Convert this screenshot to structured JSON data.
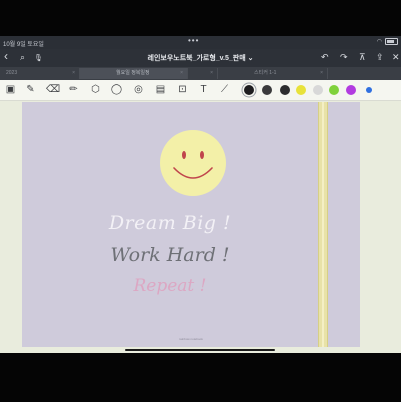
{
  "status": {
    "time": "10월 9일 토요일",
    "dots": "•••",
    "battery_label": "100%"
  },
  "nav": {
    "title": "레인보우노트북_가로형_v.5_판매",
    "title_caret": "⌄",
    "back": "‹",
    "search": "⌕",
    "mic": "🎙",
    "undo": "↶",
    "redo": "↷",
    "bookmark": "⊼",
    "share": "⇪",
    "close": "✕"
  },
  "tabs": [
    {
      "label": "2023",
      "close": "×",
      "active": false
    },
    {
      "label": "월요일 정복일정",
      "close": "×",
      "active": true
    },
    {
      "label": "",
      "close": "×",
      "active": false
    },
    {
      "label": "스티커 1-1",
      "close": "×",
      "active": false
    },
    {
      "label": "",
      "close": "",
      "active": false
    }
  ],
  "tools": [
    {
      "name": "thumbnail-icon",
      "glyph": "▣"
    },
    {
      "name": "pen-icon",
      "glyph": "✎"
    },
    {
      "name": "eraser-icon",
      "glyph": "⌫"
    },
    {
      "name": "highlighter-icon",
      "glyph": "✏"
    },
    {
      "name": "shapes-icon",
      "glyph": "⬡"
    },
    {
      "name": "lasso-icon",
      "glyph": "◯"
    },
    {
      "name": "sticker-icon",
      "glyph": "◎"
    },
    {
      "name": "image-icon",
      "glyph": "▤"
    },
    {
      "name": "camera-icon",
      "glyph": "⊡"
    },
    {
      "name": "text-icon",
      "glyph": "T"
    },
    {
      "name": "laser-icon",
      "glyph": "⟋"
    }
  ],
  "colors": {
    "swatches": [
      "#1d1d1f",
      "#3a3a3c",
      "#2c2c2e",
      "#e8e23a",
      "#d8d8d8",
      "#7fd13b",
      "#b23be0",
      "#2f6fe0"
    ],
    "screen_bg": "#e9ecdd",
    "page_bg": "#cfcbdb",
    "smiley": "#f3f0a8",
    "smiley_line": "#c0454c"
  },
  "page": {
    "line1": "Dream Big !",
    "line2": "Work Hard !",
    "line3": "Repeat !",
    "footer": "rainbow notebook"
  }
}
